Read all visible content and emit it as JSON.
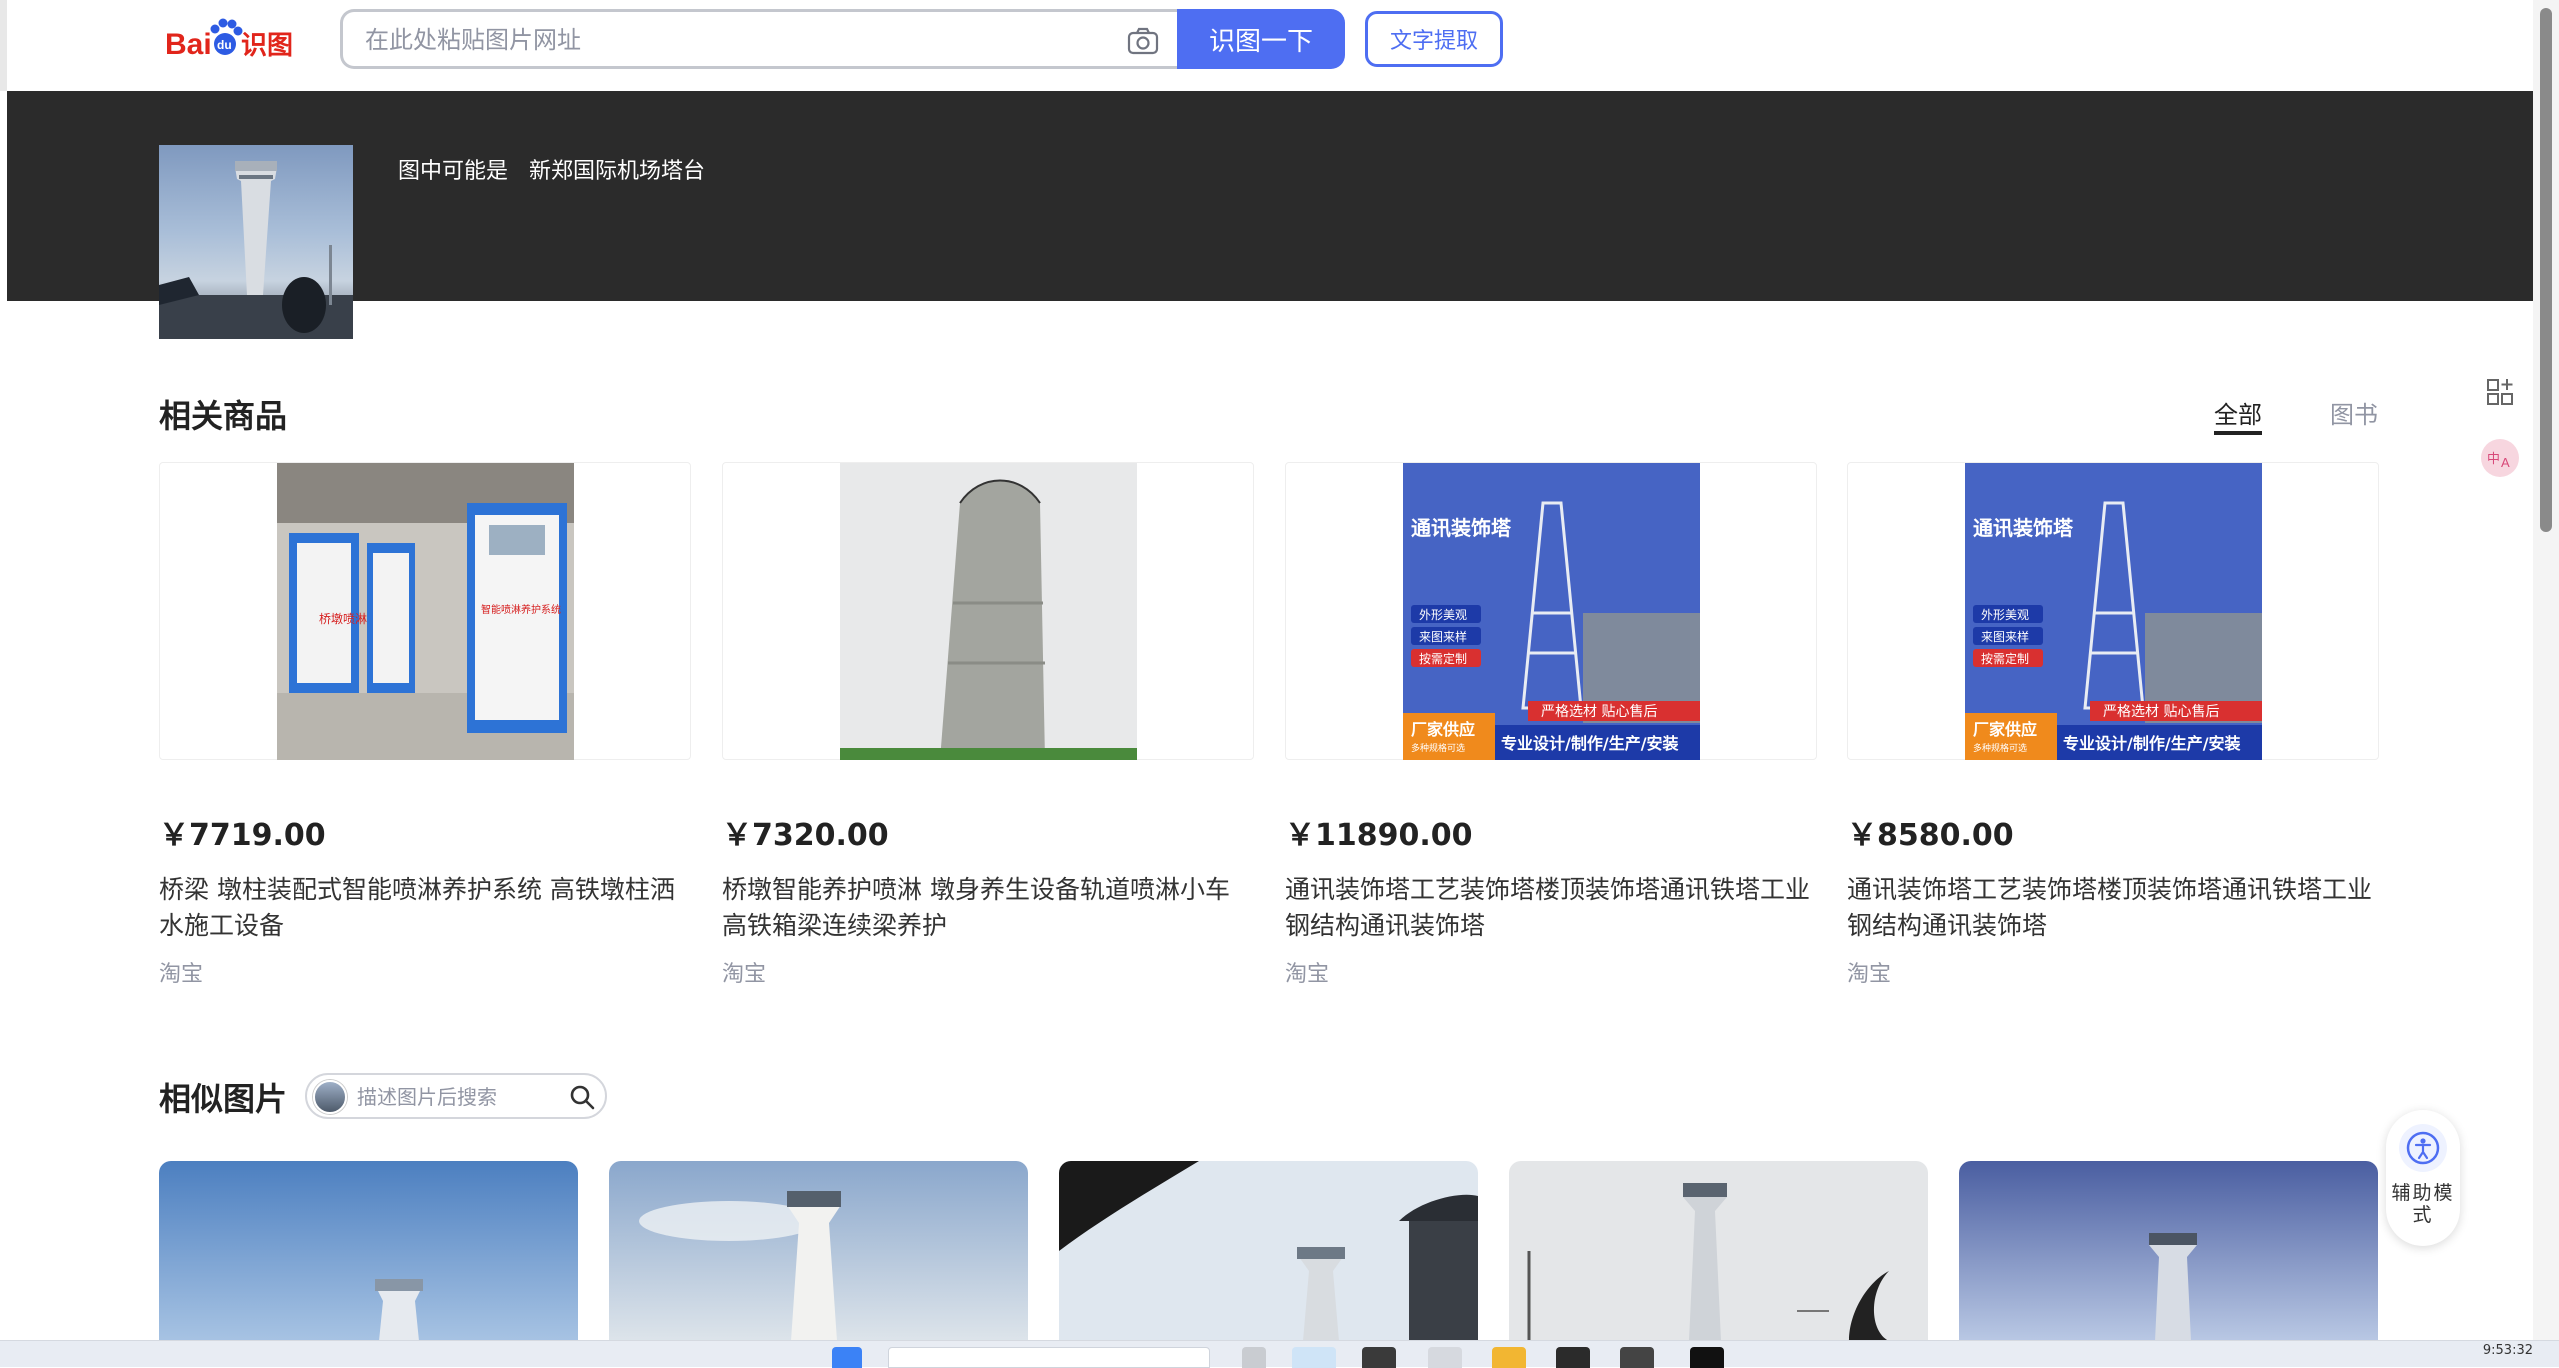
{
  "header": {
    "logo_text": "Baidu识图",
    "search_placeholder": "在此处粘贴图片网址",
    "search_button": "识图一下",
    "ocr_button": "文字提取"
  },
  "result": {
    "guess_label": "图中可能是",
    "guess_value": "新郑国际机场塔台"
  },
  "products_section": {
    "title": "相关商品",
    "tabs": [
      {
        "label": "全部",
        "active": true
      },
      {
        "label": "图书",
        "active": false
      }
    ],
    "items": [
      {
        "price": "￥7719.00",
        "title": "桥梁 墩柱装配式智能喷淋养护系统 高铁墩柱洒水施工设备",
        "source": "淘宝"
      },
      {
        "price": "￥7320.00",
        "title": "桥墩智能养护喷淋 墩身养生设备轨道喷淋小车 高铁箱梁连续梁养护",
        "source": "淘宝"
      },
      {
        "price": "￥11890.00",
        "title": "通讯装饰塔工艺装饰塔楼顶装饰塔通讯铁塔工业钢结构通讯装饰塔",
        "source": "淘宝"
      },
      {
        "price": "￥8580.00",
        "title": "通讯装饰塔工艺装饰塔楼顶装饰塔通讯铁塔工业钢结构通讯装饰塔",
        "source": "淘宝"
      }
    ],
    "product_image_text": {
      "tower_title": "通讯装饰塔",
      "tags": [
        "外形美观",
        "来图来样",
        "按需定制"
      ],
      "bottom_left": "厂家供应",
      "bottom_left_small": "多种规格可选",
      "bottom_right_top": "严格选材 贴心售后",
      "bottom_right": "专业设计/制作/生产/安装",
      "cabinet_label": "桥墩喷淋",
      "cabinet_label_2": "智能喷淋养护系统"
    }
  },
  "similar_section": {
    "title": "相似图片",
    "search_placeholder": "描述图片后搜索"
  },
  "assist": {
    "label": "辅助模式"
  },
  "taskbar": {
    "clock": "9:53:32"
  },
  "colors": {
    "brand_blue": "#4e6ef2",
    "band_dark": "#2b2b2b",
    "muted_text": "#9195a3"
  }
}
